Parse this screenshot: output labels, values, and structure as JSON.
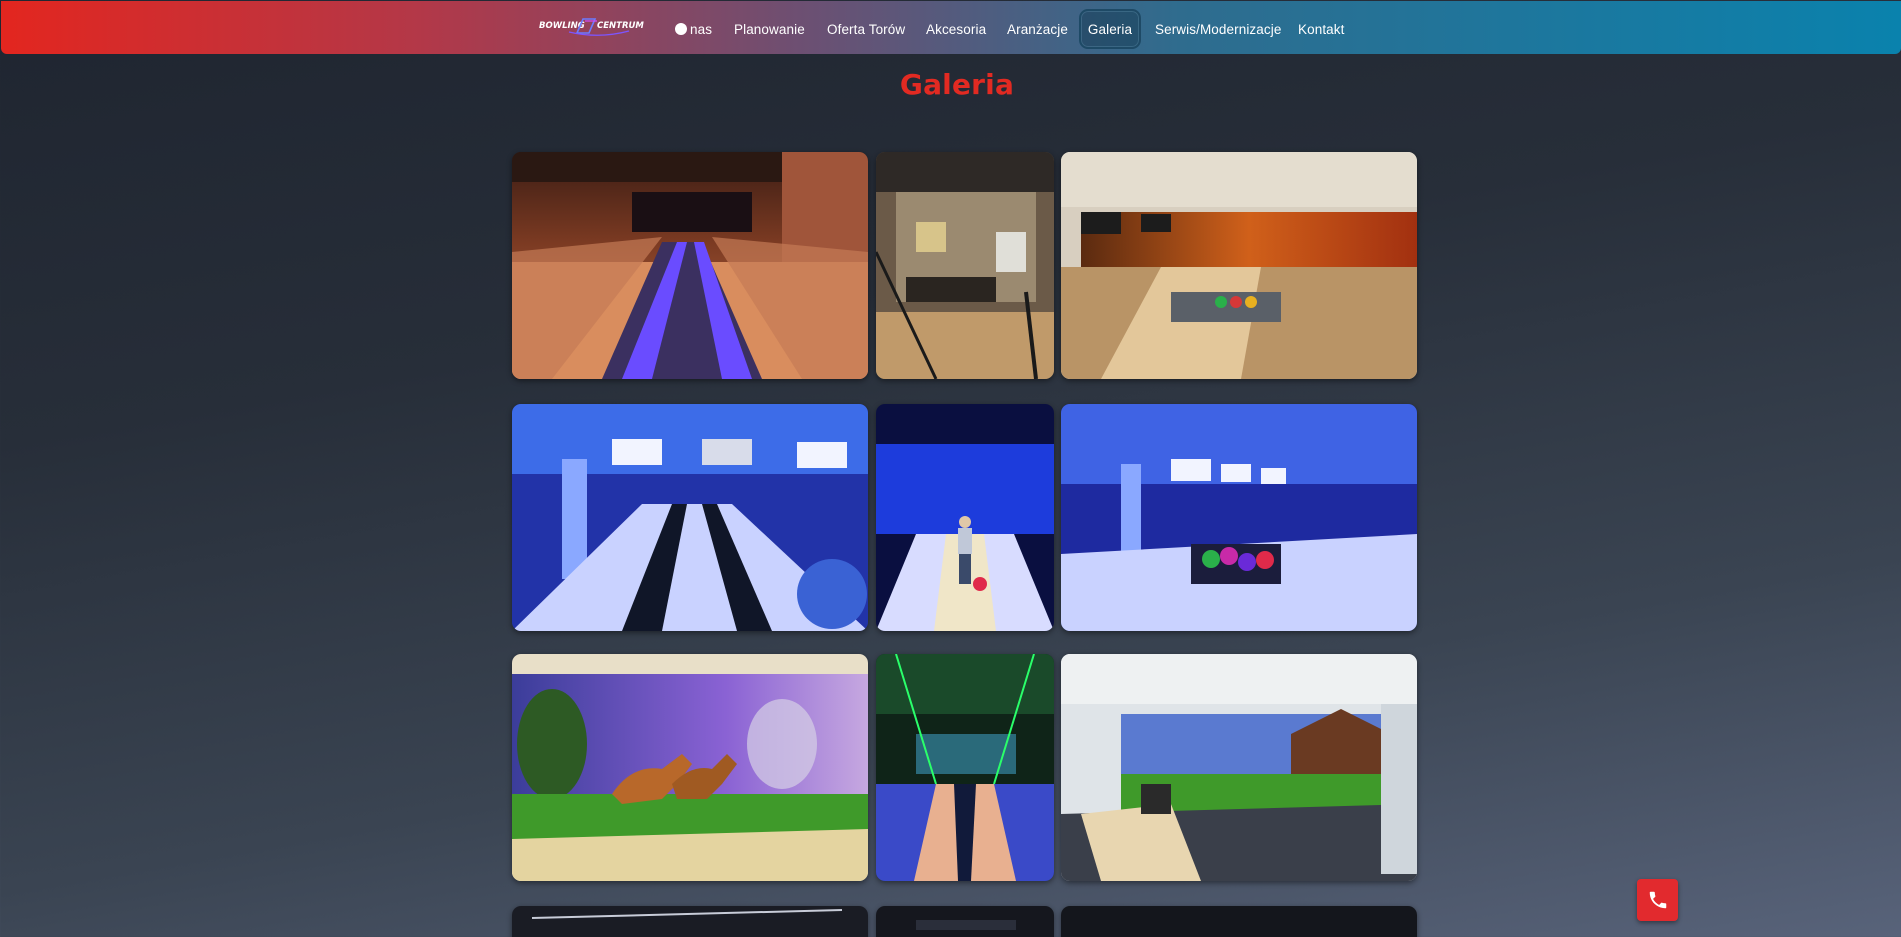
{
  "nav": {
    "logo_text_left": "BOWLING",
    "logo_text_right": "CENTRUM",
    "items": [
      {
        "label": "nas"
      },
      {
        "label": "Planowanie"
      },
      {
        "label": "Oferta Torów"
      },
      {
        "label": "Akcesoria"
      },
      {
        "label": "Aranżacje"
      },
      {
        "label": "Galeria",
        "active": true
      },
      {
        "label": "Serwis/Modernizacje"
      },
      {
        "label": "Kontakt"
      }
    ]
  },
  "page": {
    "title": "Galeria"
  },
  "gallery": {
    "photos": [
      "bowling-lanes-brick-hall-icon",
      "lounge-brick-wall-icon",
      "lanes-sunset-mural-icon",
      "blue-lanes-hall-icon",
      "bowler-blue-lane-icon",
      "blue-lanes-ball-return-icon",
      "horse-mural-lanes-icon",
      "green-neon-lane-icon",
      "barn-mural-lanes-icon"
    ]
  },
  "colors": {
    "title_red": "#e22a22",
    "nav_start": "#e3261f",
    "nav_end": "#0a82ad",
    "phone_button": "#e22a2e"
  },
  "floating": {
    "icon": "phone-icon"
  }
}
